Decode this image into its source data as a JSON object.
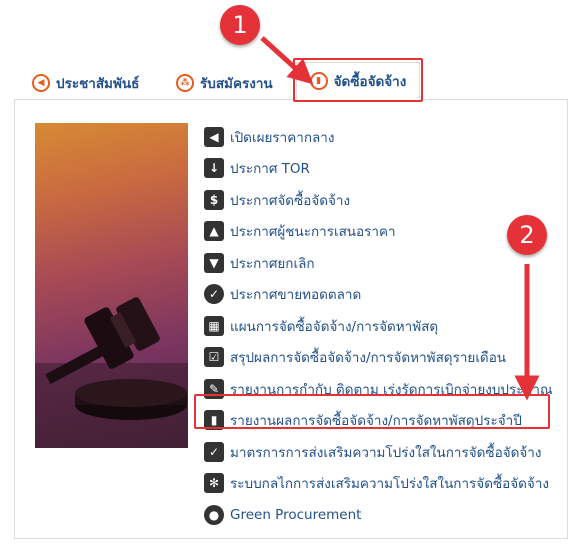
{
  "tabs": [
    {
      "label": "ประชาสัมพันธ์",
      "icon": "megaphone-icon"
    },
    {
      "label": "รับสมัครงาน",
      "icon": "users-icon"
    },
    {
      "label": "จัดซื้อจัดจ้าง",
      "icon": "bank-icon",
      "active": true
    }
  ],
  "menu": [
    {
      "label": "เปิดเผยราคากลาง",
      "icon": "bullhorn-icon"
    },
    {
      "label": "ประกาศ TOR",
      "icon": "sort-numeric-icon"
    },
    {
      "label": "ประกาศจัดซื้อจัดจ้าง",
      "icon": "dollar-icon"
    },
    {
      "label": "ประกาศผู้ชนะการเสนอราคา",
      "icon": "thumbs-up-icon"
    },
    {
      "label": "ประกาศยกเลิก",
      "icon": "thumbs-down-icon"
    },
    {
      "label": "ประกาศขายทอดตลาด",
      "icon": "check-circle-icon"
    },
    {
      "label": "แผนการจัดซื้อจัดจ้าง/การจัดหาพัสดุ",
      "icon": "calendar-icon"
    },
    {
      "label": "สรุปผลการจัดซื้อจัดจ้าง/การจัดหาพัสดุรายเดือน",
      "icon": "check-square-icon"
    },
    {
      "label": "รายงานการกำกับ ติดตาม เร่งรัดการเบิกจ่ายงบประมาณ",
      "icon": "edit-icon"
    },
    {
      "label": "รายงานผลการจัดซื้อจัดจ้าง/การจัดหาพัสดุประจำปี",
      "icon": "bar-chart-icon"
    },
    {
      "label": "มาตรการการส่งเสริมความโปร่งใสในการจัดซื้อจัดจ้าง",
      "icon": "check-list-icon"
    },
    {
      "label": "ระบบกลไกการส่งเสริมความโปร่งใสในการจัดซื้อจัดจ้าง",
      "icon": "cog-icon"
    },
    {
      "label": "Green Procurement",
      "icon": "globe-icon"
    }
  ],
  "annotations": {
    "step1": "1",
    "step2": "2"
  },
  "colors": {
    "link": "#23518b",
    "accent": "#ea5a1f",
    "callout": "#e53238"
  }
}
